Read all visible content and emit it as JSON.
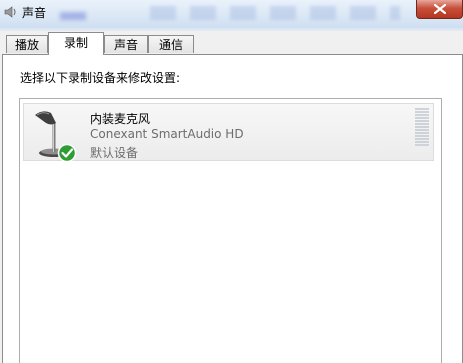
{
  "window": {
    "title": "声音",
    "title_icon": "speaker-icon",
    "close_icon": "close-icon"
  },
  "tabs": [
    {
      "label": "播放",
      "active": false
    },
    {
      "label": "录制",
      "active": true
    },
    {
      "label": "声音",
      "active": false
    },
    {
      "label": "通信",
      "active": false
    }
  ],
  "main": {
    "instruction": "选择以下录制设备来修改设置:",
    "devices": [
      {
        "name": "内装麦克风",
        "description": "Conexant SmartAudio HD",
        "status": "默认设备",
        "icon": "microphone-icon",
        "badge": "default-check-icon",
        "level_fraction": 0
      }
    ]
  },
  "colors": {
    "check_green": "#2e9d33",
    "close_red": "#c7503d",
    "meter_idle": "#cdd3d8"
  }
}
